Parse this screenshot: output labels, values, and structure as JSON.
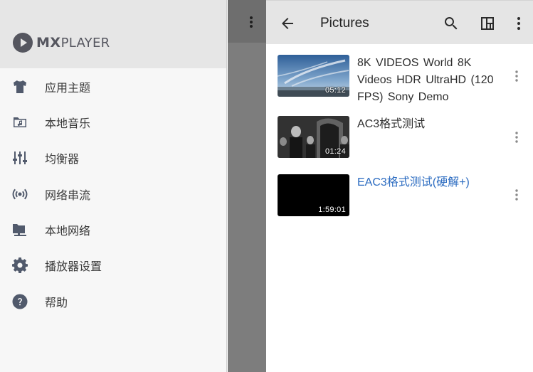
{
  "drawer": {
    "logo": {
      "mx": "MX",
      "player": "PLAYER"
    },
    "items": [
      {
        "label": "应用主题",
        "icon": "shirt-icon"
      },
      {
        "label": "本地音乐",
        "icon": "music-folder-icon"
      },
      {
        "label": "均衡器",
        "icon": "equalizer-icon"
      },
      {
        "label": "网络串流",
        "icon": "broadcast-icon"
      },
      {
        "label": "本地网络",
        "icon": "network-folder-icon"
      },
      {
        "label": "播放器设置",
        "icon": "gear-icon"
      },
      {
        "label": "帮助",
        "icon": "help-icon"
      }
    ]
  },
  "appbar": {
    "title": "Pictures",
    "icons": [
      "back-arrow-icon",
      "search-icon",
      "view-layout-icon",
      "more-vert-icon"
    ]
  },
  "videos": [
    {
      "title": "8K VIDEOS   World 8K Videos HDR UltraHD  (120 FPS)   Sony Demo",
      "duration": "05:12",
      "active": false
    },
    {
      "title": "AC3格式测试",
      "duration": "01:24",
      "active": false
    },
    {
      "title": "EAC3格式测试(硬解+)",
      "duration": "1:59:01",
      "active": true
    }
  ],
  "colors": {
    "accent_link": "#2c6cc1",
    "drawer_bg": "#f7f7f7",
    "drawer_header_bg": "#e6e6e6",
    "appbar_bg": "#e5e5e5",
    "icon_gray": "#515a6c"
  }
}
